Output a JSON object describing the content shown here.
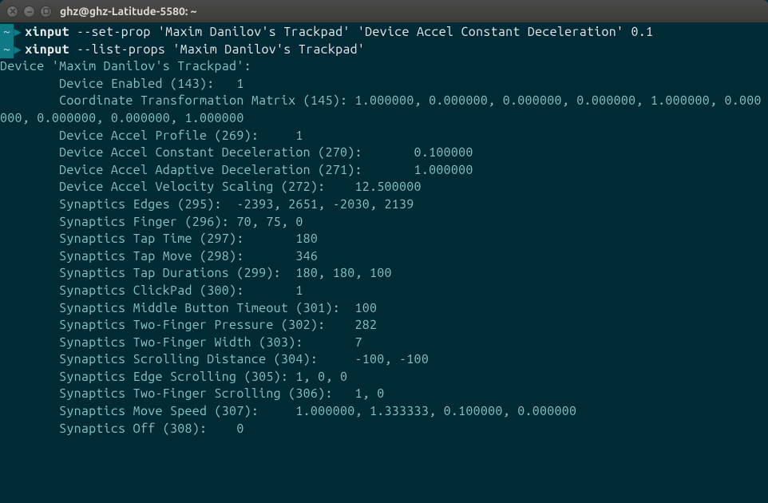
{
  "titlebar": {
    "title": "ghz@ghz-Latitude-5580: ~"
  },
  "prompt": {
    "symbol": "~",
    "arrow": "▶"
  },
  "commands": {
    "cmd1_name": "xinput",
    "cmd1_args": " --set-prop 'Maxim Danilov's Trackpad' 'Device Accel Constant Deceleration' 0.1",
    "cmd2_name": "xinput",
    "cmd2_args": " --list-props 'Maxim Danilov's Trackpad'"
  },
  "output": {
    "device_header": "Device 'Maxim Danilov's Trackpad':",
    "lines": [
      "        Device Enabled (143):   1",
      "        Coordinate Transformation Matrix (145): 1.000000, 0.000000, 0.000000, 0.000000, 1.000000, 0.000000, 0.000000, 0.000000, 1.000000",
      "        Device Accel Profile (269):     1",
      "        Device Accel Constant Deceleration (270):       0.100000",
      "        Device Accel Adaptive Deceleration (271):       1.000000",
      "        Device Accel Velocity Scaling (272):    12.500000",
      "        Synaptics Edges (295):  -2393, 2651, -2030, 2139",
      "        Synaptics Finger (296): 70, 75, 0",
      "        Synaptics Tap Time (297):       180",
      "        Synaptics Tap Move (298):       346",
      "        Synaptics Tap Durations (299):  180, 180, 100",
      "        Synaptics ClickPad (300):       1",
      "        Synaptics Middle Button Timeout (301):  100",
      "        Synaptics Two-Finger Pressure (302):    282",
      "        Synaptics Two-Finger Width (303):       7",
      "        Synaptics Scrolling Distance (304):     -100, -100",
      "        Synaptics Edge Scrolling (305): 1, 0, 0",
      "        Synaptics Two-Finger Scrolling (306):   1, 0",
      "        Synaptics Move Speed (307):     1.000000, 1.333333, 0.100000, 0.000000",
      "        Synaptics Off (308):    0"
    ]
  }
}
